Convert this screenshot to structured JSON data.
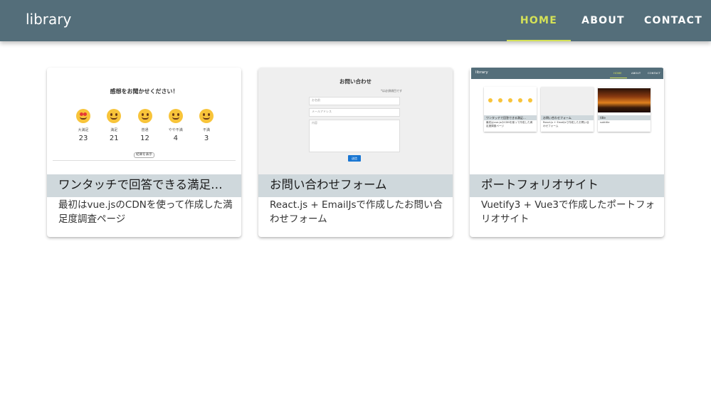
{
  "app": {
    "title": "library"
  },
  "nav": {
    "items": [
      {
        "label": "HOME",
        "active": true
      },
      {
        "label": "ABOUT"
      },
      {
        "label": "CONTACT"
      }
    ]
  },
  "colors": {
    "appbar": "#546e7a",
    "accent": "#d4e157",
    "card_title_bg": "#cfd8dc"
  },
  "cards": [
    {
      "title": "ワンタッチで回答できる満足…",
      "description": "最初はvue.jsのCDNを使って作成した満足度調査ページ",
      "preview": {
        "question": "感想をお聞かせください！",
        "options": [
          {
            "icon": "heart-eyes-face-icon",
            "label": "大満足",
            "count": "23"
          },
          {
            "icon": "smiling-face-icon",
            "label": "満足",
            "count": "21"
          },
          {
            "icon": "neutral-face-icon",
            "label": "普通",
            "count": "12"
          },
          {
            "icon": "skeptical-face-icon",
            "label": "やや不満",
            "count": "4"
          },
          {
            "icon": "frustrated-face-icon",
            "label": "不満",
            "count": "3"
          }
        ],
        "result_button": "結果を表示"
      }
    },
    {
      "title": "お問い合わせフォーム",
      "description": "React.js + EmailJsで作成したお問い合わせフォーム",
      "preview": {
        "heading": "お問い合わせ",
        "required_note": "*は必須項目です",
        "name_placeholder": "お名前",
        "email_placeholder": "メールアドレス",
        "message_placeholder": "内容",
        "send_label": "送信"
      }
    },
    {
      "title": "ポートフォリオサイト",
      "description": "Vuetify3 + Vue3で作成したポートフォリオサイト",
      "preview": {
        "brand": "library",
        "nav": [
          "HOME",
          "ABOUT",
          "CONTACT"
        ],
        "mini_cards": [
          {
            "title": "ワンタッチで回答できる満足…",
            "text": "最初はvue.jsのCDNを使って作成した満足度調査ページ"
          },
          {
            "title": "お問い合わせフォーム",
            "text": "React.js + EmailJsで作成したお問い合わせフォーム"
          },
          {
            "title": "title",
            "text": "subtitle"
          }
        ]
      }
    }
  ]
}
